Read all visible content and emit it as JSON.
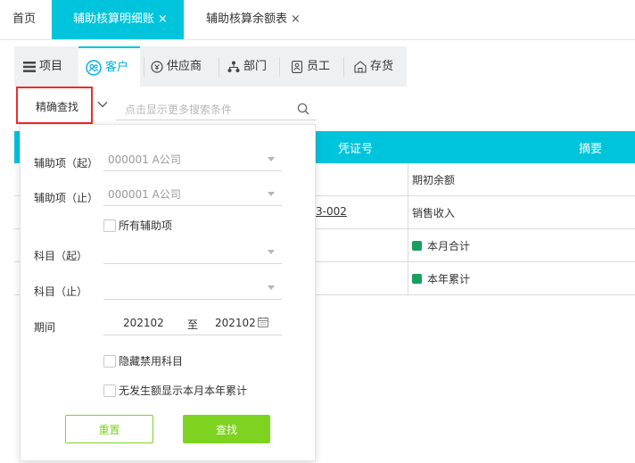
{
  "top_tabs": [
    {
      "label": "首页",
      "closable": false,
      "active": false
    },
    {
      "label": "辅助核算明细账",
      "closable": true,
      "active": true
    },
    {
      "label": "辅助核算余额表",
      "closable": true,
      "active": false
    }
  ],
  "close_glyph": "×",
  "category_tabs": [
    {
      "label": "项目",
      "icon": "list-icon"
    },
    {
      "label": "客户",
      "icon": "customer-icon",
      "active": true
    },
    {
      "label": "供应商",
      "icon": "supplier-icon"
    },
    {
      "label": "部门",
      "icon": "department-icon"
    },
    {
      "label": "员工",
      "icon": "employee-icon"
    },
    {
      "label": "存货",
      "icon": "warehouse-icon"
    }
  ],
  "search": {
    "mode_label": "精确查找",
    "placeholder": "点击显示更多搜索条件"
  },
  "table": {
    "headers": {
      "voucher": "凭证号",
      "summary": "摘要"
    },
    "rows": [
      {
        "voucher": "",
        "summary": "期初余额",
        "tag": false
      },
      {
        "voucher": "3-002",
        "summary": "销售收入",
        "tag": false
      },
      {
        "voucher": "",
        "summary": "本月合计",
        "tag": true
      },
      {
        "voucher": "",
        "summary": "本年累计",
        "tag": true
      }
    ]
  },
  "filter_panel": {
    "aux_from_label": "辅助项（起）",
    "aux_from_value": "000001 A公司",
    "aux_to_label": "辅助项（止）",
    "aux_to_value": "000001 A公司",
    "all_aux_label": "所有辅助项",
    "subject_from_label": "科目（起）",
    "subject_from_value": "",
    "subject_to_label": "科目（止）",
    "subject_to_value": "",
    "period_label": "期间",
    "period_from": "202102",
    "period_to_label": "至",
    "period_to": "202102",
    "hide_disabled_label": "隐藏禁用科目",
    "no_amount_label": "无发生额显示本月本年累计",
    "reset_label": "重置",
    "find_label": "查找"
  },
  "colors": {
    "accent": "#00c4dc",
    "link_blue": "#00aee0",
    "highlight_border": "#ee2b2b",
    "button_green": "#7ed321",
    "tag_green": "#17a05d"
  }
}
